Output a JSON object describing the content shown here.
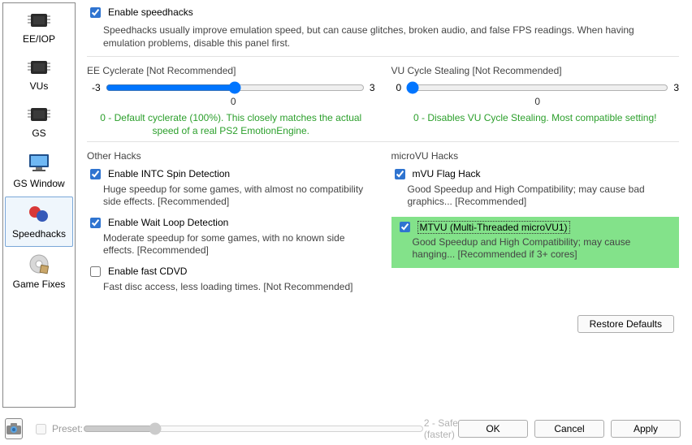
{
  "sidebar": {
    "items": [
      {
        "label": "EE/IOP"
      },
      {
        "label": "VUs"
      },
      {
        "label": "GS"
      },
      {
        "label": "GS Window"
      },
      {
        "label": "Speedhacks"
      },
      {
        "label": "Game Fixes"
      }
    ]
  },
  "header": {
    "enable_label": "Enable speedhacks",
    "enable_desc": "Speedhacks usually improve emulation speed, but can cause glitches, broken audio, and false FPS readings.  When having emulation problems, disable this panel first."
  },
  "ee_cyclerate": {
    "title": "EE Cyclerate [Not Recommended]",
    "min": "-3",
    "max": "3",
    "value": "0",
    "center": "0",
    "desc": "0 - Default cyclerate (100%). This closely matches the actual speed of a real PS2 EmotionEngine."
  },
  "vu_cycle": {
    "title": "VU Cycle Stealing [Not Recommended]",
    "min": "0",
    "max": "3",
    "value": "0",
    "center": "0",
    "desc": "0 - Disables VU Cycle Stealing.  Most compatible setting!"
  },
  "other_hacks": {
    "title": "Other Hacks",
    "intc_label": "Enable INTC Spin Detection",
    "intc_desc": "Huge speedup for some games, with almost no compatibility side effects. [Recommended]",
    "wait_label": "Enable Wait Loop Detection",
    "wait_desc": "Moderate speedup for some games, with no known side effects. [Recommended]",
    "cdvd_label": "Enable fast CDVD",
    "cdvd_desc": "Fast disc access, less loading times. [Not Recommended]"
  },
  "microvu": {
    "title": "microVU Hacks",
    "flag_label": "mVU Flag Hack",
    "flag_desc": "Good Speedup and High Compatibility; may cause bad graphics... [Recommended]",
    "mtvu_label": "MTVU (Multi-Threaded microVU1)",
    "mtvu_desc": "Good Speedup and High Compatibility; may cause hanging... [Recommended if 3+ cores]"
  },
  "restore_label": "Restore Defaults",
  "bottom": {
    "preset_label": "Preset:",
    "preset_desc": "2 - Safe (faster)",
    "ok": "OK",
    "cancel": "Cancel",
    "apply": "Apply"
  }
}
